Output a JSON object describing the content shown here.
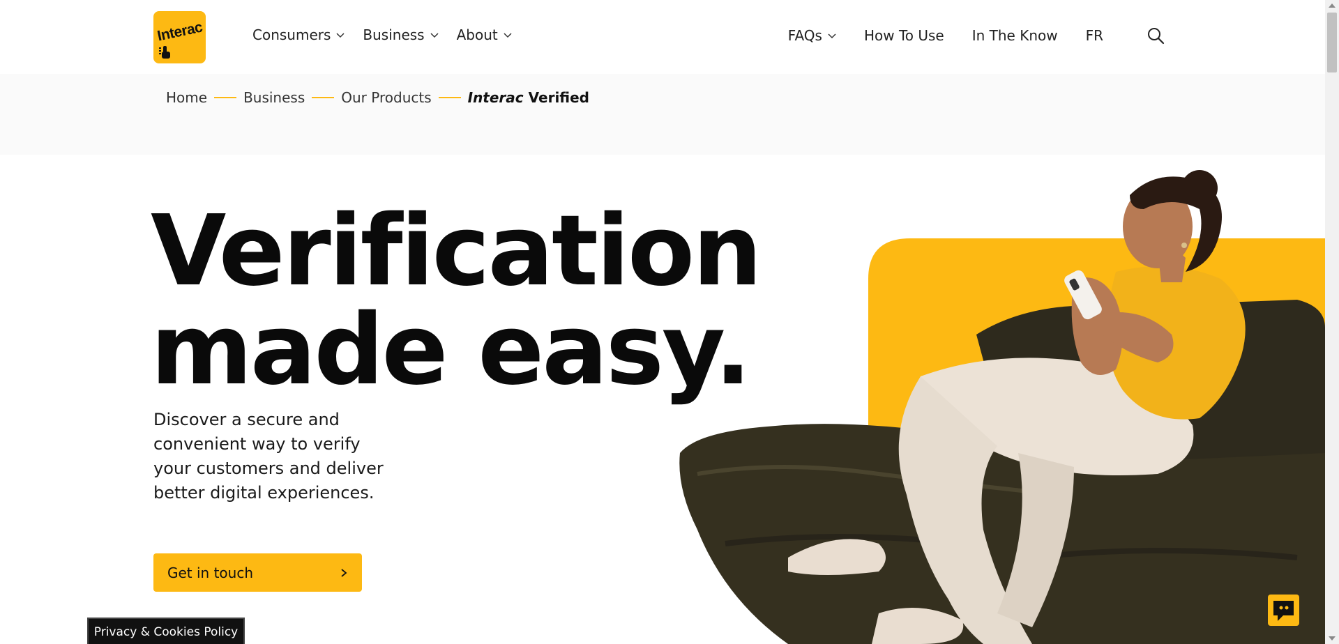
{
  "header": {
    "logo_text": "Interac",
    "nav_left": [
      {
        "label": "Consumers",
        "has_dropdown": true
      },
      {
        "label": "Business",
        "has_dropdown": true
      },
      {
        "label": "About",
        "has_dropdown": true
      }
    ],
    "nav_right": [
      {
        "label": "FAQs",
        "has_dropdown": true
      },
      {
        "label": "How To Use",
        "has_dropdown": false
      },
      {
        "label": "In The Know",
        "has_dropdown": false
      },
      {
        "label": "FR",
        "has_dropdown": false
      }
    ],
    "search_icon": "search-icon"
  },
  "breadcrumb": {
    "items": [
      "Home",
      "Business",
      "Our Products"
    ],
    "current_brand": "Interac",
    "current_rest": "Verified"
  },
  "hero": {
    "title_line1": "Verification",
    "title_line2": "made easy.",
    "description": "Discover a secure and convenient way to verify your customers and deliver better digital experiences.",
    "cta_label": "Get in touch"
  },
  "footer": {
    "privacy_label": "Privacy & Cookies Policy",
    "chat_icon": "chat-icon"
  },
  "colors": {
    "accent": "#fdb913",
    "text": "#111111",
    "band": "#fafafa"
  }
}
